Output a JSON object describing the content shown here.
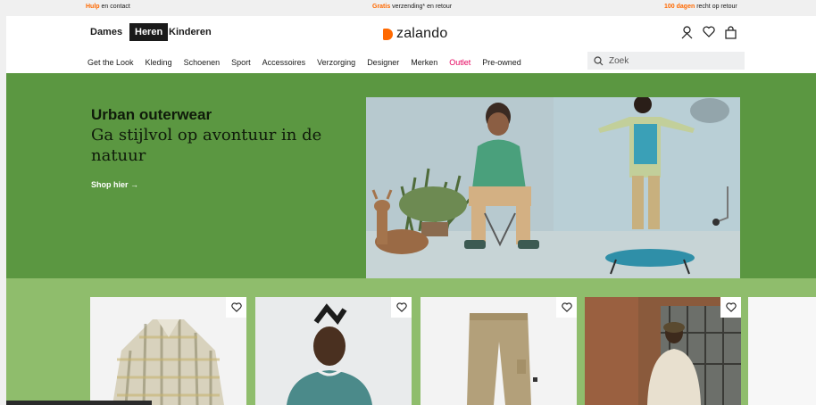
{
  "topbar": {
    "help_orange": "Hulp",
    "help_rest": " en contact",
    "shipping_orange": "Gratis",
    "shipping_rest": " verzending* en retour",
    "returns_orange": "100 dagen",
    "returns_rest": " recht op retour"
  },
  "header": {
    "genders": [
      "Dames",
      "Heren",
      "Kinderen"
    ],
    "logo": "zalando",
    "search_placeholder": "Zoek"
  },
  "nav": [
    "Get the Look",
    "Kleding",
    "Schoenen",
    "Sport",
    "Accessoires",
    "Verzorging",
    "Designer",
    "Merken",
    "Outlet",
    "Pre-owned"
  ],
  "hero": {
    "title": "Urban outerwear",
    "subtitle": "Ga stijlvol op avontuur in de natuur",
    "cta": "Shop hier →"
  },
  "colors": {
    "accent": "#ff6900",
    "outlet": "#e5005c",
    "hero_bg": "#5b9741",
    "band_bg": "#8fbd6c"
  },
  "icons": [
    "user-icon",
    "heart-icon",
    "bag-icon",
    "search-icon"
  ]
}
